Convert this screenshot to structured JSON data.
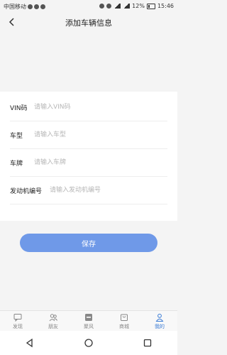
{
  "status": {
    "carrier": "中国移动",
    "battery": "12%",
    "time": "15:46"
  },
  "nav": {
    "title": "添加车辆信息"
  },
  "form": {
    "fields": [
      {
        "label": "VIN码",
        "placeholder": "请输入VIN码"
      },
      {
        "label": "车型",
        "placeholder": "请输入车型"
      },
      {
        "label": "车牌",
        "placeholder": "请输入车牌"
      },
      {
        "label": "发动机编号",
        "placeholder": "请输入发动机编号"
      }
    ]
  },
  "save": {
    "label": "保存"
  },
  "tabs": [
    {
      "label": "发现",
      "icon": "chat-bubble-icon"
    },
    {
      "label": "朋友",
      "icon": "friends-icon"
    },
    {
      "label": "聚风",
      "icon": "gather-icon"
    },
    {
      "label": "商城",
      "icon": "shop-bag-icon"
    },
    {
      "label": "我的",
      "icon": "person-icon"
    }
  ],
  "colors": {
    "accent": "#6f99e8",
    "active_tab": "#3a7bd5"
  }
}
